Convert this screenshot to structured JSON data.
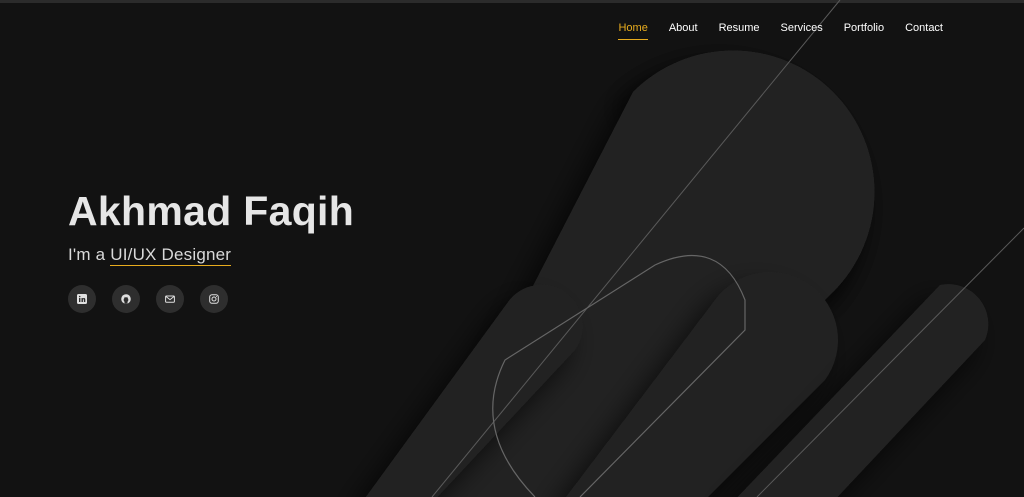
{
  "nav": {
    "items": [
      {
        "label": "Home",
        "active": true
      },
      {
        "label": "About",
        "active": false
      },
      {
        "label": "Resume",
        "active": false
      },
      {
        "label": "Services",
        "active": false
      },
      {
        "label": "Portfolio",
        "active": false
      },
      {
        "label": "Contact",
        "active": false
      }
    ]
  },
  "hero": {
    "name": "Akhmad Faqih",
    "tagline_prefix": "I'm a",
    "role": "UI/UX Designer"
  },
  "social": [
    {
      "icon": "linkedin-icon"
    },
    {
      "icon": "github-icon"
    },
    {
      "icon": "mail-icon"
    },
    {
      "icon": "instagram-icon"
    }
  ],
  "colors": {
    "accent": "#e8ac1e",
    "background": "#121212",
    "shape": "#262626"
  }
}
